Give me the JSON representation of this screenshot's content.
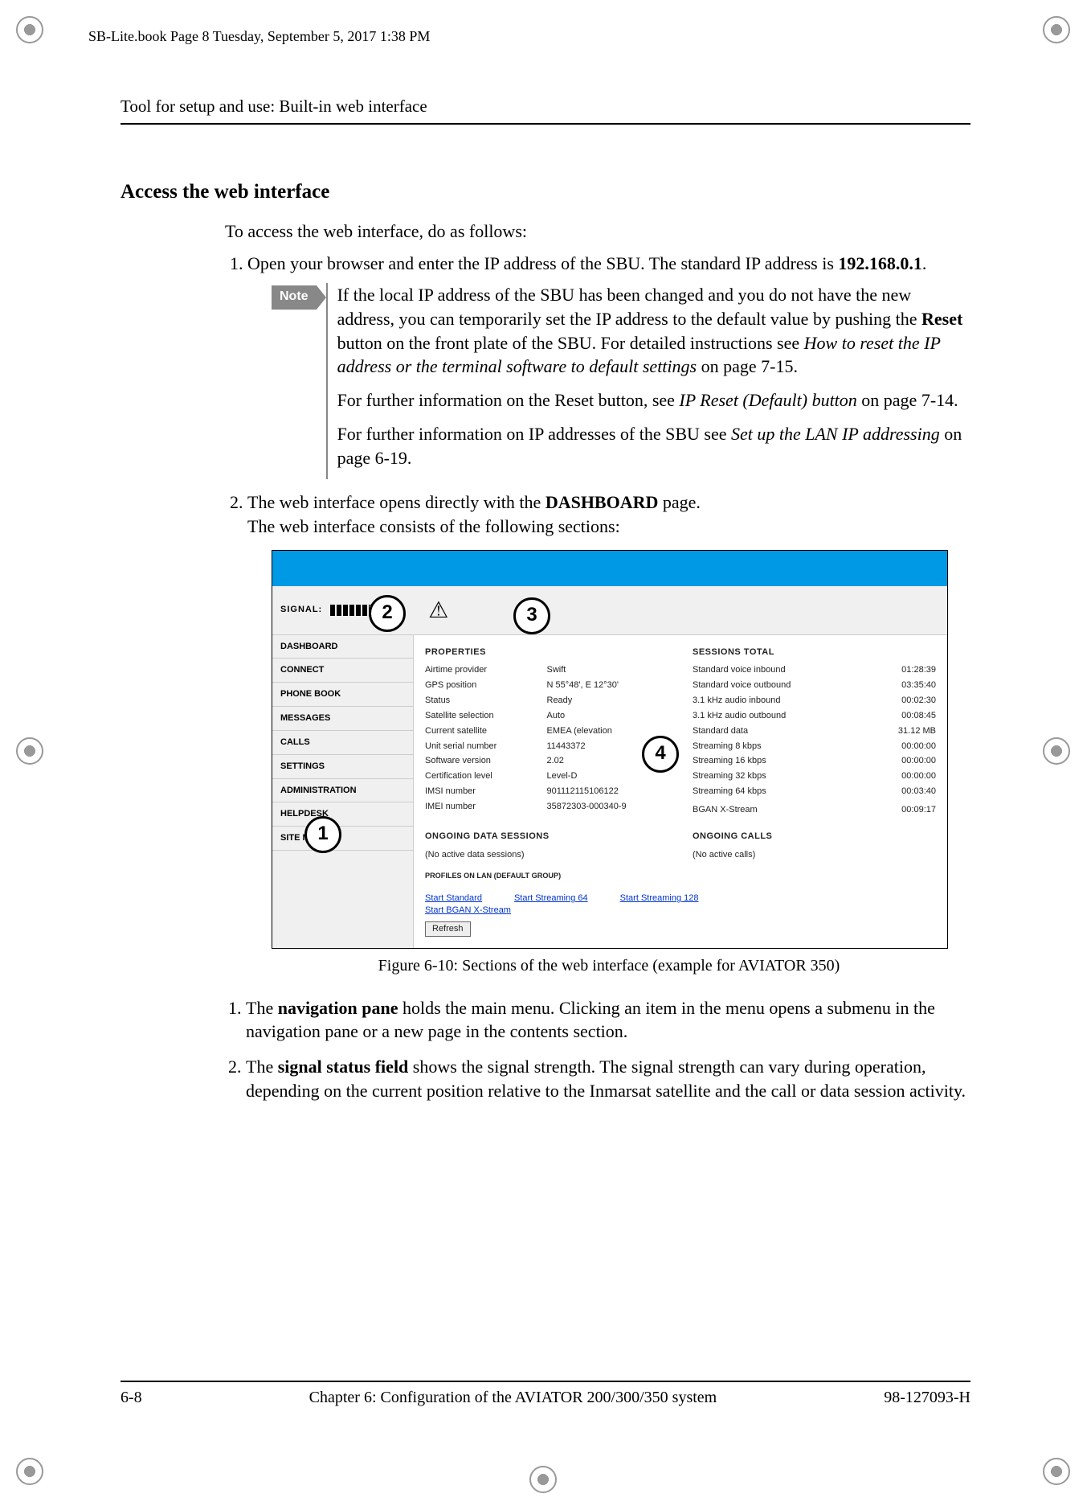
{
  "meta_line": "SB-Lite.book  Page 8  Tuesday, September 5, 2017  1:38 PM",
  "running_head": "Tool for setup and use: Built-in web interface",
  "h2": "Access the web interface",
  "intro": "To access the web interface, do as follows:",
  "step1_a": "Open your browser and enter the IP address of the SBU. The standard IP address is ",
  "step1_ip": "192.168.0.1",
  "step1_b": ".",
  "note_label": "Note",
  "note_p1_a": "If the local IP address of the SBU has been changed and you do not have the new address, you can temporarily set the IP address to the default value by pushing the ",
  "note_p1_b": "Reset",
  "note_p1_c": " button on the front plate of the SBU. For detailed instructions see ",
  "note_p1_d": "How to reset the IP address or the terminal software to default settings",
  "note_p1_e": " on page 7-15.",
  "note_p2_a": "For further information on the Reset button, see ",
  "note_p2_b": "IP Reset (Default) button",
  "note_p2_c": " on page 7-14.",
  "note_p3_a": "For further information on IP addresses of the SBU see ",
  "note_p3_b": "Set up the LAN IP addressing",
  "note_p3_c": " on page 6-19.",
  "step2_a": "The web interface opens directly with the ",
  "step2_b": "DASHBOARD",
  "step2_c": " page.",
  "step2_line2": "The web interface consists of the following sections:",
  "caption": "Figure 6-10: Sections of the web interface (example for AVIATOR 350)",
  "desc1_a": "The ",
  "desc1_b": "navigation pane",
  "desc1_c": " holds the main menu. Clicking an item in the menu opens a submenu in the navigation pane or a new page in the contents section.",
  "desc2_a": "The ",
  "desc2_b": "signal status field",
  "desc2_c": " shows the signal strength. The signal strength can vary during operation, depending on the current position relative to the Inmarsat satellite and the call or data session activity.",
  "footer_left": "6-8",
  "footer_center": "Chapter 6:  Configuration of the AVIATOR 200/300/350 system",
  "footer_right": "98-127093-H",
  "callouts": {
    "c1": "1",
    "c2": "2",
    "c3": "3",
    "c4": "4"
  },
  "fig": {
    "signal_label": "SIGNAL:",
    "nav": [
      "DASHBOARD",
      "CONNECT",
      "PHONE BOOK",
      "MESSAGES",
      "CALLS",
      "SETTINGS",
      "ADMINISTRATION",
      "HELPDESK",
      "SITE MAP"
    ],
    "props_h": "PROPERTIES",
    "sess_h": "SESSIONS TOTAL",
    "props": [
      {
        "k": "Airtime provider",
        "v": "Swift"
      },
      {
        "k": "GPS position",
        "v": "N 55°48', E 12°30'"
      },
      {
        "k": "Status",
        "v": "Ready"
      },
      {
        "k": "Satellite selection",
        "v": "Auto"
      },
      {
        "k": "Current satellite",
        "v": "EMEA (elevation"
      },
      {
        "k": "Unit serial number",
        "v": "11443372"
      },
      {
        "k": "Software version",
        "v": "2.02"
      },
      {
        "k": "Certification level",
        "v": "Level-D"
      },
      {
        "k": "IMSI number",
        "v": "901112115106122"
      },
      {
        "k": "IMEI number",
        "v": "35872303-000340-9"
      }
    ],
    "sess": [
      {
        "k": "Standard voice inbound",
        "v": "01:28:39"
      },
      {
        "k": "Standard voice outbound",
        "v": "03:35:40"
      },
      {
        "k": "3.1 kHz audio inbound",
        "v": "00:02:30"
      },
      {
        "k": "3.1 kHz audio outbound",
        "v": "00:08:45"
      },
      {
        "k": "Standard data",
        "v": "31.12 MB"
      },
      {
        "k": "Streaming 8 kbps",
        "v": "00:00:00"
      },
      {
        "k": "Streaming 16 kbps",
        "v": "00:00:00"
      },
      {
        "k": "Streaming 32 kbps",
        "v": "00:00:00"
      },
      {
        "k": "Streaming 64 kbps",
        "v": "00:03:40"
      },
      {
        "k": "",
        "v": ""
      },
      {
        "k": "BGAN X-Stream",
        "v": "00:09:17"
      }
    ],
    "ods_h": "ONGOING DATA SESSIONS",
    "ods_v": "(No active data sessions)",
    "oc_h": "ONGOING CALLS",
    "oc_v": "(No active calls)",
    "profiles_h": "PROFILES ON LAN (DEFAULT GROUP)",
    "links": [
      "Start Standard",
      "Start Streaming 64",
      "Start Streaming 128",
      "Start BGAN X-Stream"
    ],
    "refresh": "Refresh"
  }
}
